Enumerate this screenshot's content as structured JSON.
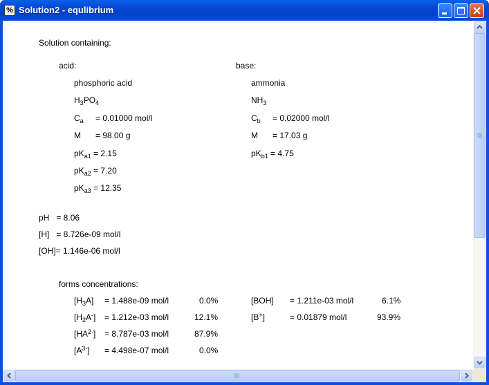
{
  "window": {
    "title": "Solution2 - equlibrium",
    "icon": "percent-icon"
  },
  "content": {
    "heading": "Solution containing:",
    "acid": {
      "label": "acid:",
      "name": "phosphoric acid",
      "formula": {
        "a": "H",
        "b": "3",
        "c": "PO",
        "d": "4"
      },
      "c": {
        "sym": "C",
        "sub": "a",
        "value": "= 0.01000 mol/l"
      },
      "m": {
        "sym": "M",
        "value": "= 98.00 g"
      },
      "pk1": {
        "sym": "pK",
        "sub": "a1",
        "value": "= 2.15"
      },
      "pk2": {
        "sym": "pK",
        "sub": "a2",
        "value": "= 7.20"
      },
      "pk3": {
        "sym": "pK",
        "sub": "a3",
        "value": "= 12.35"
      }
    },
    "base": {
      "label": "base:",
      "name": "ammonia",
      "formula": {
        "a": "NH",
        "b": "3"
      },
      "c": {
        "sym": "C",
        "sub": "b",
        "value": "= 0.02000 mol/l"
      },
      "m": {
        "sym": "M",
        "value": "= 17.03 g"
      },
      "pk1": {
        "sym": "pK",
        "sub": "b1",
        "value": "= 4.75"
      }
    },
    "results": {
      "ph": "pH   = 8.06",
      "h": "[H]   = 8.726e-09 mol/l",
      "oh": "[OH]= 1.146e-06 mol/l"
    },
    "forms": {
      "heading": "forms concentrations:",
      "acid_rows": [
        {
          "a": "[H",
          "b": "3",
          "c": "A]",
          "value": "= 1.488e-09 mol/l",
          "pct": "0.0%"
        },
        {
          "a": "[H",
          "b": "2",
          "c": "A",
          "d": "-",
          "e": "]",
          "value": "= 1.212e-03 mol/l",
          "pct": "12.1%"
        },
        {
          "a": "[HA",
          "b": "2-",
          "c": "]",
          "value": "= 8.787e-03 mol/l",
          "pct": "87.9%"
        },
        {
          "a": "[A",
          "b": "3-",
          "c": "]",
          "value": "= 4.498e-07 mol/l",
          "pct": "0.0%"
        }
      ],
      "base_rows": [
        {
          "a": "[BOH]",
          "value": "= 1.211e-03 mol/l",
          "pct": "6.1%"
        },
        {
          "a": "[B",
          "b": "+",
          "c": "]",
          "value": "= 0.01879 mol/l",
          "pct": "93.9%"
        }
      ]
    }
  }
}
